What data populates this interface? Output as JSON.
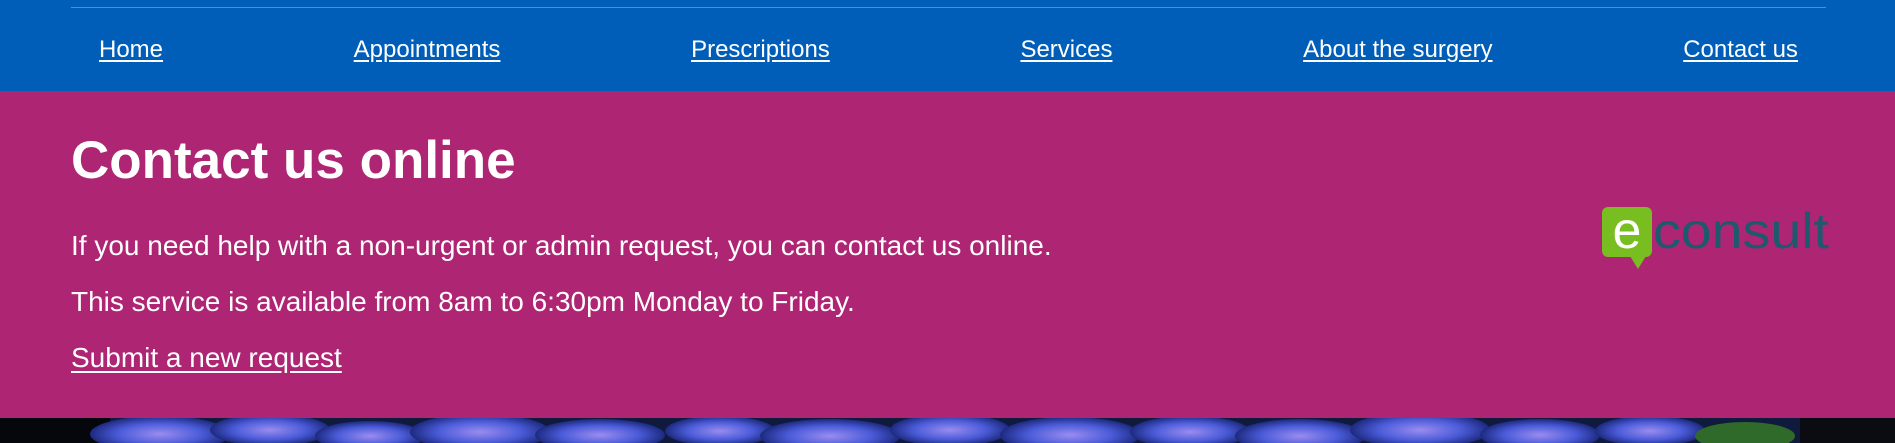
{
  "nav": {
    "items": [
      {
        "label": "Home"
      },
      {
        "label": "Appointments"
      },
      {
        "label": "Prescriptions"
      },
      {
        "label": "Services"
      },
      {
        "label": "About the surgery"
      },
      {
        "label": "Contact us"
      }
    ]
  },
  "contact": {
    "title": "Contact us online",
    "paragraphs": [
      "If you need help with a non-urgent or admin request, you can contact us online.",
      "This service is available from 8am to 6:30pm Monday to Friday."
    ],
    "submit_link": "Submit a new request",
    "logo": {
      "letter": "e",
      "word": "consult"
    }
  },
  "colors": {
    "nav_background": "#005eb8",
    "banner_background": "#ae2573",
    "logo_green": "#78be20",
    "logo_text": "#1d5a6e"
  },
  "decorative": {
    "footer_image": "hydrangea-flowers"
  }
}
